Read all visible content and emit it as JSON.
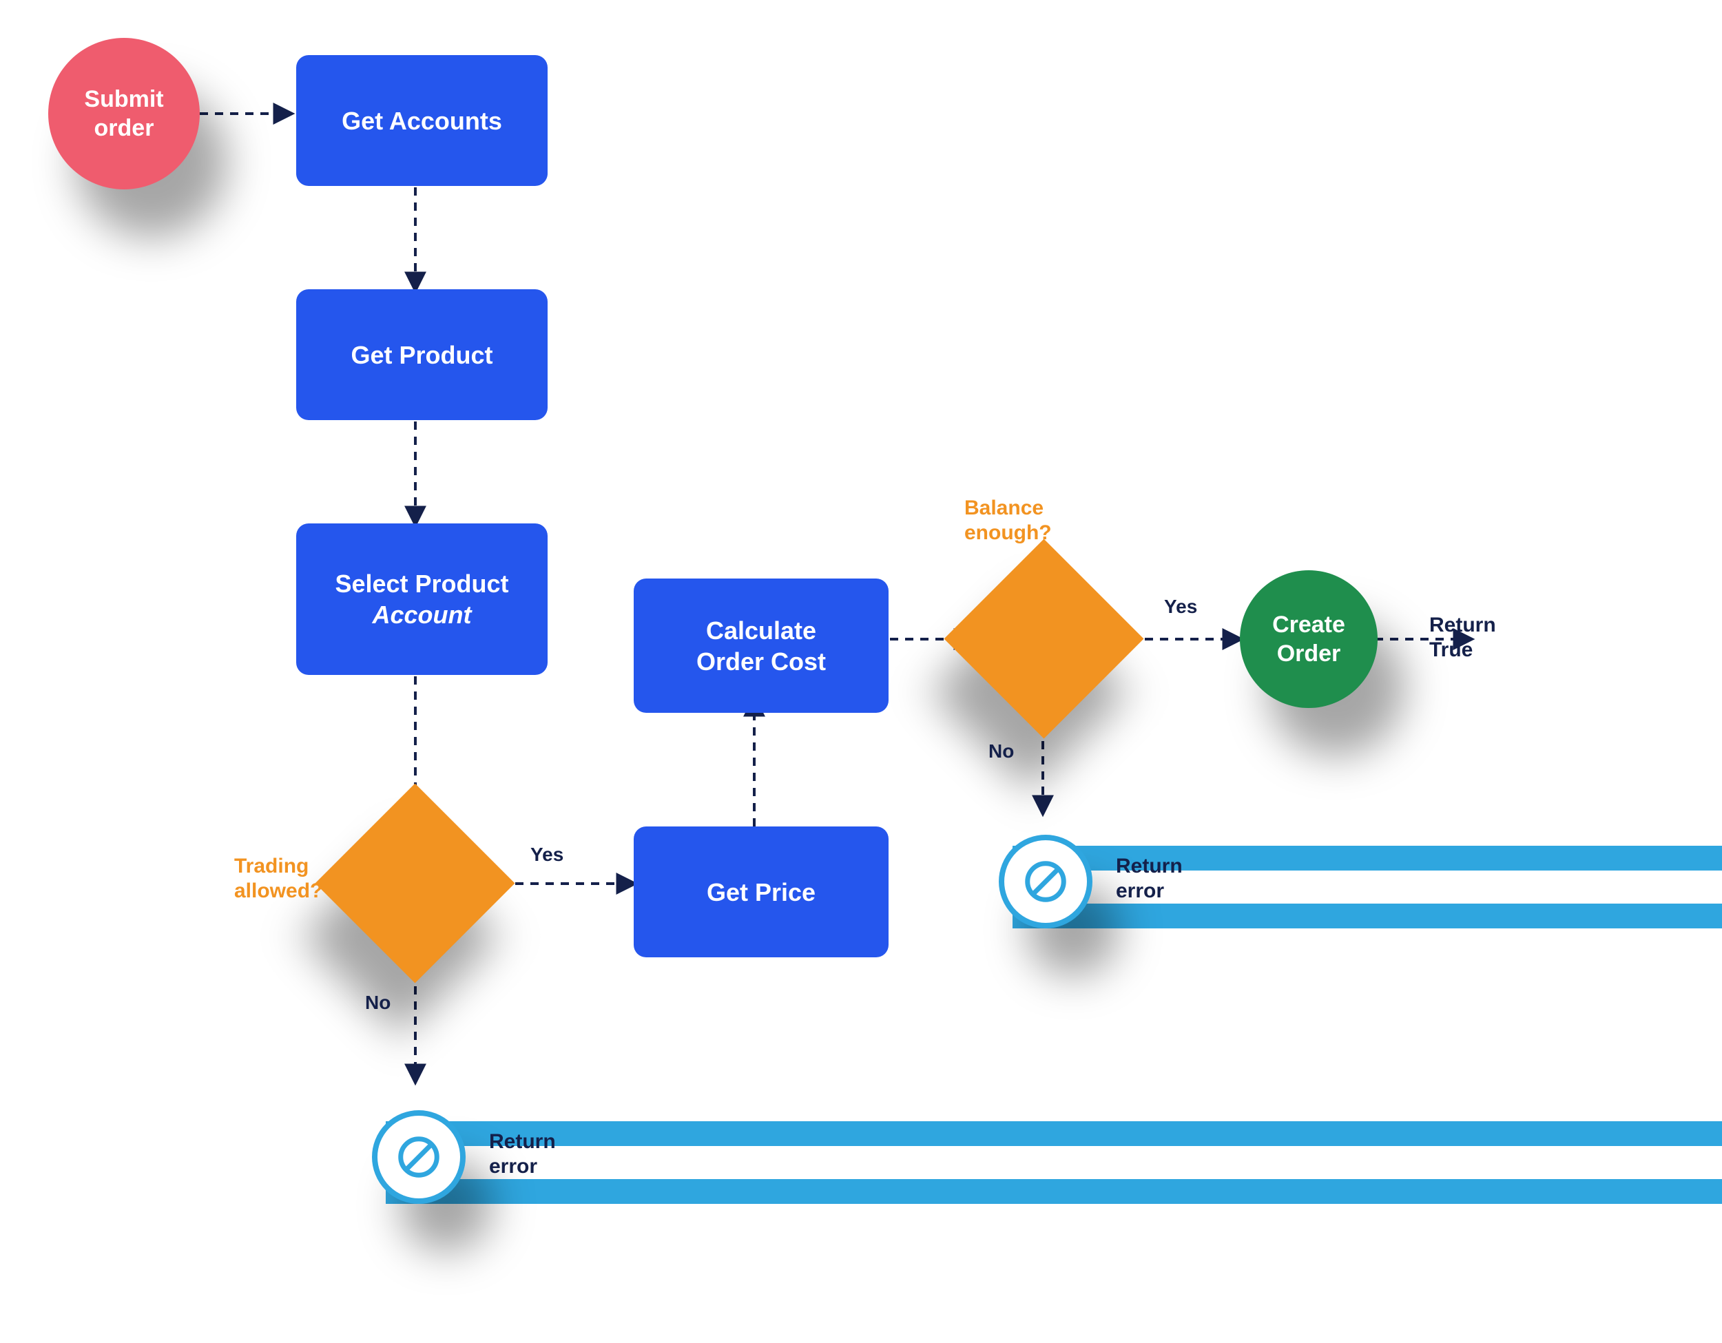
{
  "colors": {
    "process": "#2556ED",
    "start": "#EF5C6E",
    "end": "#1F8E4D",
    "decision": "#F29321",
    "errorBar": "#2FA6DF",
    "edge": "#14204A"
  },
  "nodes": {
    "start": {
      "label": "Submit\norder"
    },
    "getAccounts": {
      "label": "Get Accounts"
    },
    "getProduct": {
      "label": "Get Product"
    },
    "selectProductAccount": {
      "line1": "Select Product",
      "line2": "Account"
    },
    "tradingAllowed": {
      "question": "Trading\nallowed?"
    },
    "getPrice": {
      "label": "Get Price"
    },
    "calcCost": {
      "label": "Calculate\nOrder Cost"
    },
    "balanceEnough": {
      "question": "Balance\nenough?"
    },
    "createOrder": {
      "label": "Create\nOrder"
    },
    "returnTrue": {
      "label": "Return\nTrue"
    },
    "error1": {
      "label": "Return\nerror"
    },
    "error2": {
      "label": "Return\nerror"
    }
  },
  "edges": {
    "yes": "Yes",
    "no": "No"
  }
}
